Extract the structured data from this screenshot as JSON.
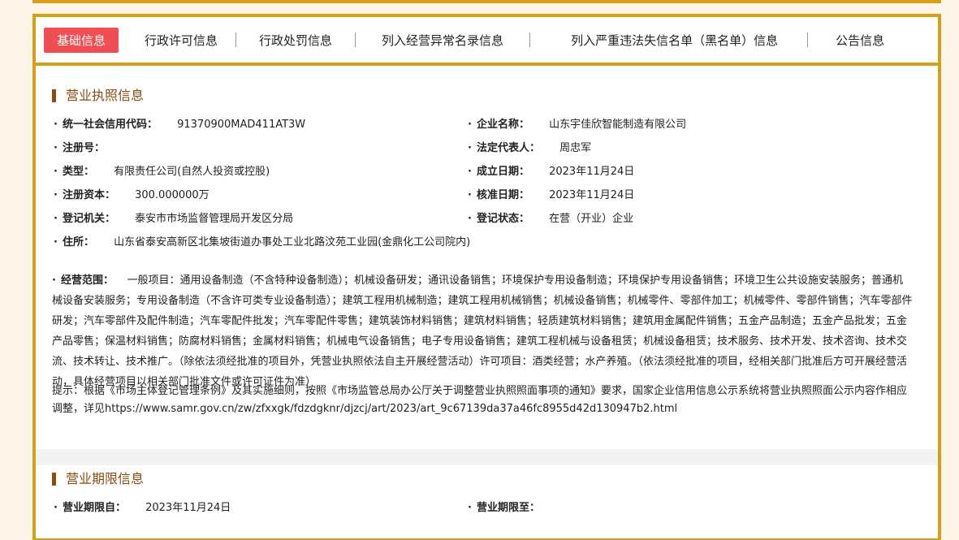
{
  "tabs": [
    {
      "label": "基础信息",
      "active": true
    },
    {
      "label": "行政许可信息"
    },
    {
      "label": "行政处罚信息"
    },
    {
      "label": "列入经营异常名录信息"
    },
    {
      "label": "列入严重违法失信名单（黑名单）信息"
    },
    {
      "label": "公告信息"
    }
  ],
  "license": {
    "title": "营业执照信息",
    "credit_code_label": "统一社会信用代码：",
    "credit_code": "91370900MAD411AT3W",
    "company_name_label": "企业名称：",
    "company_name": "山东宇佳欣智能制造有限公司",
    "reg_no_label": "注册号：",
    "reg_no": "",
    "legal_rep_label": "法定代表人：",
    "legal_rep": "周忠军",
    "type_label": "类型：",
    "type": "有限责任公司(自然人投资或控股)",
    "established_label": "成立日期：",
    "established": "2023年11月24日",
    "capital_label": "注册资本：",
    "capital": "300.000000万",
    "approved_label": "核准日期：",
    "approved": "2023年11月24日",
    "authority_label": "登记机关：",
    "authority": "泰安市市场监督管理局开发区分局",
    "status_label": "登记状态：",
    "status": "在营（开业）企业",
    "address_label": "住所：",
    "address": "山东省泰安高新区北集坡街道办事处工业北路汶苑工业园(金鼎化工公司院内)",
    "scope_label": "经营范围：",
    "scope": "一般项目：通用设备制造（不含特种设备制造）；机械设备研发；通讯设备销售；环境保护专用设备制造；环境保护专用设备销售；环境卫生公共设施安装服务；普通机械设备安装服务；专用设备制造（不含许可类专业设备制造）；建筑工程用机械制造；建筑工程用机械销售；机械设备销售；机械零件、零部件加工；机械零件、零部件销售；汽车零部件研发；汽车零部件及配件制造；汽车零配件批发；汽车零配件零售；建筑装饰材料销售；建筑材料销售；轻质建筑材料销售；建筑用金属配件销售；五金产品制造；五金产品批发；五金产品零售；保温材料销售；防腐材料销售；金属材料销售；机械电气设备销售；电子专用设备销售；建筑工程机械与设备租赁；机械设备租赁；技术服务、技术开发、技术咨询、技术交流、技术转让、技术推广。（除依法须经批准的项目外，凭营业执照依法自主开展经营活动）许可项目：酒类经营；水产养殖。（依法须经批准的项目，经相关部门批准后方可开展经营活动，具体经营项目以相关部门批准文件或许可证件为准）",
    "tip": "提示：根据《市场主体登记管理条例》及其实施细则，按照《市场监管总局办公厅关于调整营业执照照面事项的通知》要求，国家企业信用信息公示系统将营业执照照面公示内容作相应调整，详见https://www.samr.gov.cn/zw/zfxxgk/fdzdgknr/djzcj/art/2023/art_9c67139da37a46fc8955d42d130947b2.html"
  },
  "term": {
    "title": "营业期限信息",
    "from_label": "营业期限自：",
    "from": "2023年11月24日",
    "to_label": "营业期限至：",
    "to": ""
  },
  "colors": {
    "accent_border": "#d4a017",
    "active_tab": "#f04e52",
    "section_title": "#8a4b0f"
  }
}
